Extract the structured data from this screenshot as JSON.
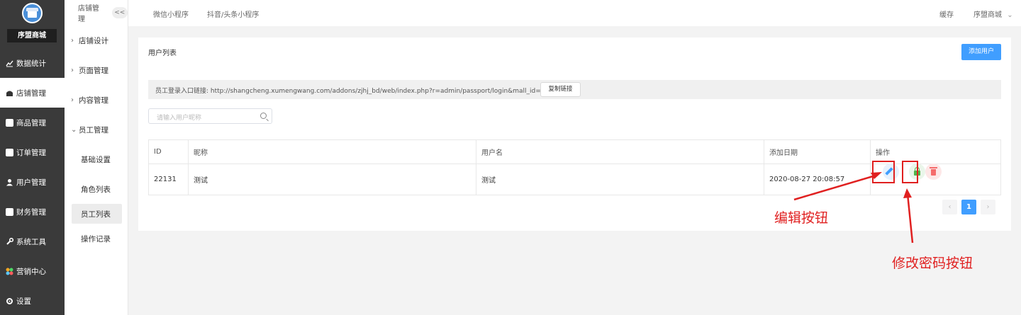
{
  "sidebar": {
    "shop_name": "序盟商城",
    "items": [
      {
        "label": "数据统计",
        "icon": "chart-icon"
      },
      {
        "label": "店铺管理",
        "icon": "shop-icon"
      },
      {
        "label": "商品管理",
        "icon": "goods-icon"
      },
      {
        "label": "订单管理",
        "icon": "order-icon"
      },
      {
        "label": "用户管理",
        "icon": "user-icon"
      },
      {
        "label": "财务管理",
        "icon": "finance-icon"
      },
      {
        "label": "系统工具",
        "icon": "wrench-icon"
      },
      {
        "label": "营销中心",
        "icon": "marketing-icon"
      },
      {
        "label": "设置",
        "icon": "gear-icon"
      }
    ],
    "active_index": 1
  },
  "submenu": {
    "title": "店铺管理",
    "collapse_label": "<<",
    "groups": [
      {
        "label": "店铺设计"
      },
      {
        "label": "页面管理"
      },
      {
        "label": "内容管理"
      },
      {
        "label": "员工管理"
      }
    ],
    "children": [
      {
        "label": "基础设置"
      },
      {
        "label": "角色列表"
      },
      {
        "label": "员工列表"
      },
      {
        "label": "操作记录"
      }
    ],
    "active_child": 2
  },
  "topbar": {
    "tabs": [
      "微信小程序",
      "抖音/头条小程序"
    ],
    "cache_label": "缓存",
    "account_label": "序盟商城"
  },
  "page": {
    "title": "用户列表",
    "add_button": "添加用户",
    "login_link_label": "员工登录入口链接:",
    "login_link_url": "http://shangcheng.xumengwang.com/addons/zjhj_bd/web/index.php?r=admin/passport/login&mall_id=NTA=",
    "copy_button": "复制链接",
    "search_placeholder": "请输入用户昵称"
  },
  "table": {
    "headers": [
      "ID",
      "昵称",
      "用户名",
      "添加日期",
      "操作"
    ],
    "rows": [
      {
        "id": "22131",
        "nickname": "测试",
        "username": "测试",
        "date": "2020-08-27 20:08:57"
      }
    ]
  },
  "pagination": {
    "prev": "‹",
    "current": "1",
    "next": "›"
  },
  "annotations": {
    "edit": "编辑按钮",
    "password": "修改密码按钮"
  },
  "colors": {
    "primary": "#409eff",
    "annotation": "#e02020",
    "sidebar_bg": "#3a3a3a"
  }
}
